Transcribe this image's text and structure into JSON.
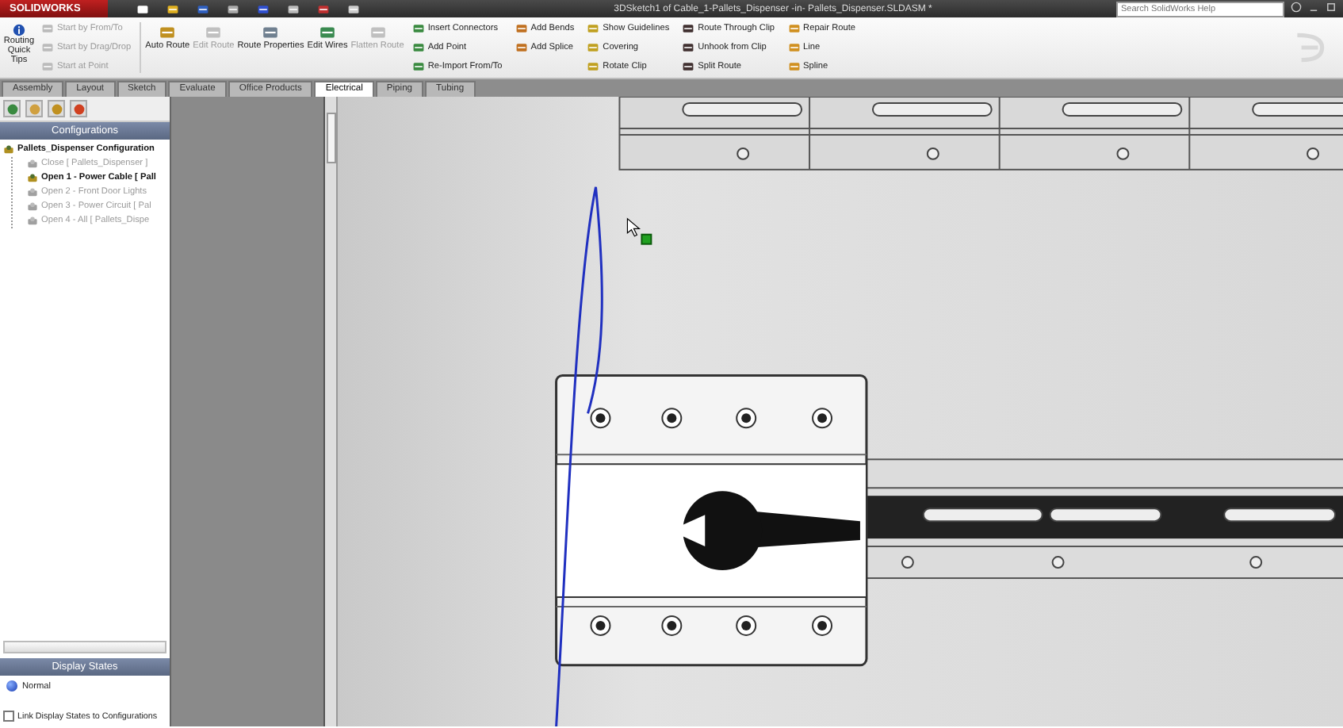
{
  "window": {
    "logo": "SOLIDWORKS",
    "title": "3DSketch1 of Cable_1-Pallets_Dispenser -in- Pallets_Dispenser.SLDASM *"
  },
  "search": {
    "placeholder": "Search SolidWorks Help"
  },
  "ribbon": {
    "quick_tips": {
      "label": "Routing Quick Tips"
    },
    "start_items": [
      {
        "label": "Start by From/To",
        "disabled": true
      },
      {
        "label": "Start by Drag/Drop",
        "disabled": true
      },
      {
        "label": "Start at Point",
        "disabled": true
      }
    ],
    "big_buttons": [
      {
        "label": "Auto Route",
        "disabled": false
      },
      {
        "label": "Edit Route",
        "disabled": true
      },
      {
        "label": "Route Properties",
        "disabled": false
      },
      {
        "label": "Edit Wires",
        "disabled": false
      },
      {
        "label": "Flatten Route",
        "disabled": true
      }
    ],
    "columns": [
      [
        "Insert Connectors",
        "Add Point",
        "Re-Import From/To"
      ],
      [
        "Add Bends",
        "Add Splice"
      ],
      [
        "Show Guidelines",
        "Covering",
        "Rotate Clip"
      ],
      [
        "Route Through Clip",
        "Unhook from Clip",
        "Split Route"
      ],
      [
        "Repair Route",
        "Line",
        "Spline"
      ]
    ]
  },
  "tabs": [
    {
      "label": "Assembly",
      "selected": false
    },
    {
      "label": "Layout",
      "selected": false
    },
    {
      "label": "Sketch",
      "selected": false
    },
    {
      "label": "Evaluate",
      "selected": false
    },
    {
      "label": "Office Products",
      "selected": false
    },
    {
      "label": "Electrical",
      "selected": true
    },
    {
      "label": "Piping",
      "selected": false
    },
    {
      "label": "Tubing",
      "selected": false
    }
  ],
  "configurations": {
    "title": "Configurations",
    "tree": [
      {
        "label": "Pallets_Dispenser Configuration",
        "active": true,
        "children": [
          {
            "label": "Close [ Pallets_Dispenser ]",
            "active": false
          },
          {
            "label": "Open 1 - Power Cable [ Pall",
            "active": true
          },
          {
            "label": "Open 2 - Front Door Lights",
            "active": false
          },
          {
            "label": "Open 3 - Power Circuit [ Pal",
            "active": false
          },
          {
            "label": "Open 4 - All [ Pallets_Dispe",
            "active": false
          }
        ]
      }
    ]
  },
  "display_states": {
    "title": "Display States",
    "items": [
      {
        "label": "Normal"
      }
    ],
    "link_option": {
      "label": "Link Display States to Configurations",
      "checked": false
    }
  }
}
